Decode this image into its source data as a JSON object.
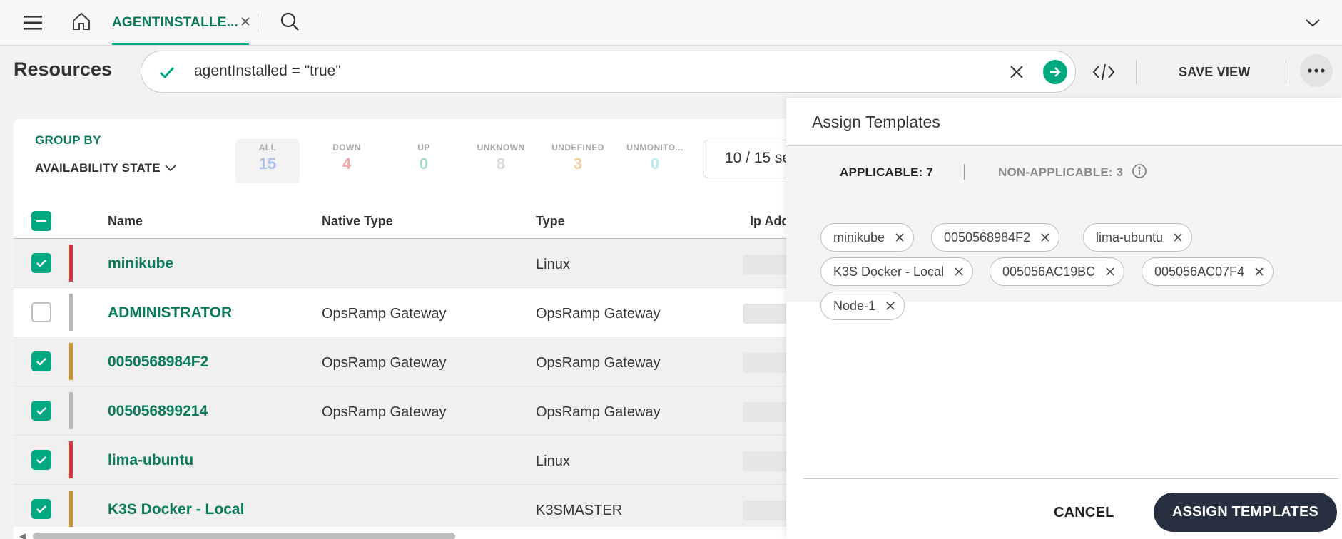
{
  "topbar": {
    "tab_label": "AGENTINSTALLE...",
    "icons": [
      "menu-icon",
      "home-icon",
      "close-icon",
      "search-icon",
      "chevron-down-icon"
    ]
  },
  "header": {
    "title": "Resources",
    "query": "agentInstalled = \"true\"",
    "save_view": "SAVE VIEW"
  },
  "groupby": {
    "label": "GROUP BY",
    "value": "AVAILABILITY STATE"
  },
  "stats": [
    {
      "label": "ALL",
      "value": "15",
      "color": "#a9c1e8"
    },
    {
      "label": "DOWN",
      "value": "4",
      "color": "#f3a6a6"
    },
    {
      "label": "UP",
      "value": "0",
      "color": "#a8dcc8"
    },
    {
      "label": "UNKNOWN",
      "value": "8",
      "color": "#d9d9d9"
    },
    {
      "label": "UNDEFINED",
      "value": "3",
      "color": "#eccf9c"
    },
    {
      "label": "UNMONITO...",
      "value": "0",
      "color": "#b8ecf2"
    }
  ],
  "selection_count": "10 / 15 se",
  "table": {
    "columns": [
      "Name",
      "Native Type",
      "Type",
      "Ip Add"
    ],
    "rows": [
      {
        "name": "minikube",
        "native_type": "",
        "type": "Linux",
        "checked": true,
        "status_color": "#e0303a"
      },
      {
        "name": "ADMINISTRATOR",
        "native_type": "OpsRamp Gateway",
        "type": "OpsRamp Gateway",
        "checked": false,
        "status_color": "#b6b6bd"
      },
      {
        "name": "0050568984F2",
        "native_type": "OpsRamp Gateway",
        "type": "OpsRamp Gateway",
        "checked": true,
        "status_color": "#c8962a"
      },
      {
        "name": "005056899214",
        "native_type": "OpsRamp Gateway",
        "type": "OpsRamp Gateway",
        "checked": true,
        "status_color": "#b6b6bd"
      },
      {
        "name": "lima-ubuntu",
        "native_type": "",
        "type": "Linux",
        "checked": true,
        "status_color": "#e0303a"
      },
      {
        "name": "K3S Docker - Local",
        "native_type": "",
        "type": "K3SMASTER",
        "checked": true,
        "status_color": "#c8962a"
      }
    ]
  },
  "drawer": {
    "title": "Assign Templates",
    "applicable": "APPLICABLE: 7",
    "non_applicable": "NON-APPLICABLE: 3",
    "chips": [
      "minikube",
      "0050568984F2",
      "lima-ubuntu",
      "K3S Docker - Local",
      "005056AC19BC",
      "005056AC07F4",
      "Node-1"
    ],
    "cancel": "CANCEL",
    "assign": "ASSIGN TEMPLATES"
  },
  "colors": {
    "accent": "#01a982",
    "link": "#0b7a5a",
    "primary_button": "#263040"
  }
}
